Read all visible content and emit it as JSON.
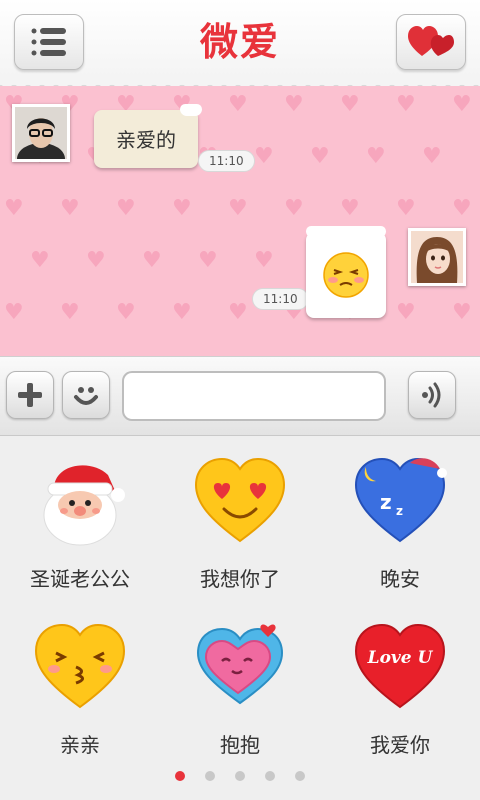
{
  "header": {
    "title": "微爱",
    "menu_icon": "list-icon",
    "right_icon": "hearts-icon",
    "accent": "#e8333b"
  },
  "chat": {
    "background": "#fbc1d0",
    "messages": [
      {
        "sender": "me",
        "text": "亲爱的",
        "time": "11:10"
      },
      {
        "sender": "her",
        "emoji": "blushing-face",
        "time": "11:10"
      }
    ]
  },
  "input_bar": {
    "add_icon": "plus-icon",
    "emoji_icon": "smiley-icon",
    "voice_icon": "sound-wave-icon",
    "text_value": ""
  },
  "emoticons": [
    {
      "label": "圣诞老公公",
      "icon": "santa-face"
    },
    {
      "label": "我想你了",
      "icon": "heart-eyes-heart"
    },
    {
      "label": "晚安",
      "icon": "sleeping-heart"
    },
    {
      "label": "亲亲",
      "icon": "kissing-heart"
    },
    {
      "label": "抱抱",
      "icon": "hugging-heart"
    },
    {
      "label": "我爱你",
      "icon": "love-u-heart"
    }
  ],
  "love_u_text": "Love U",
  "pager": {
    "pages": 5,
    "current": 1
  }
}
